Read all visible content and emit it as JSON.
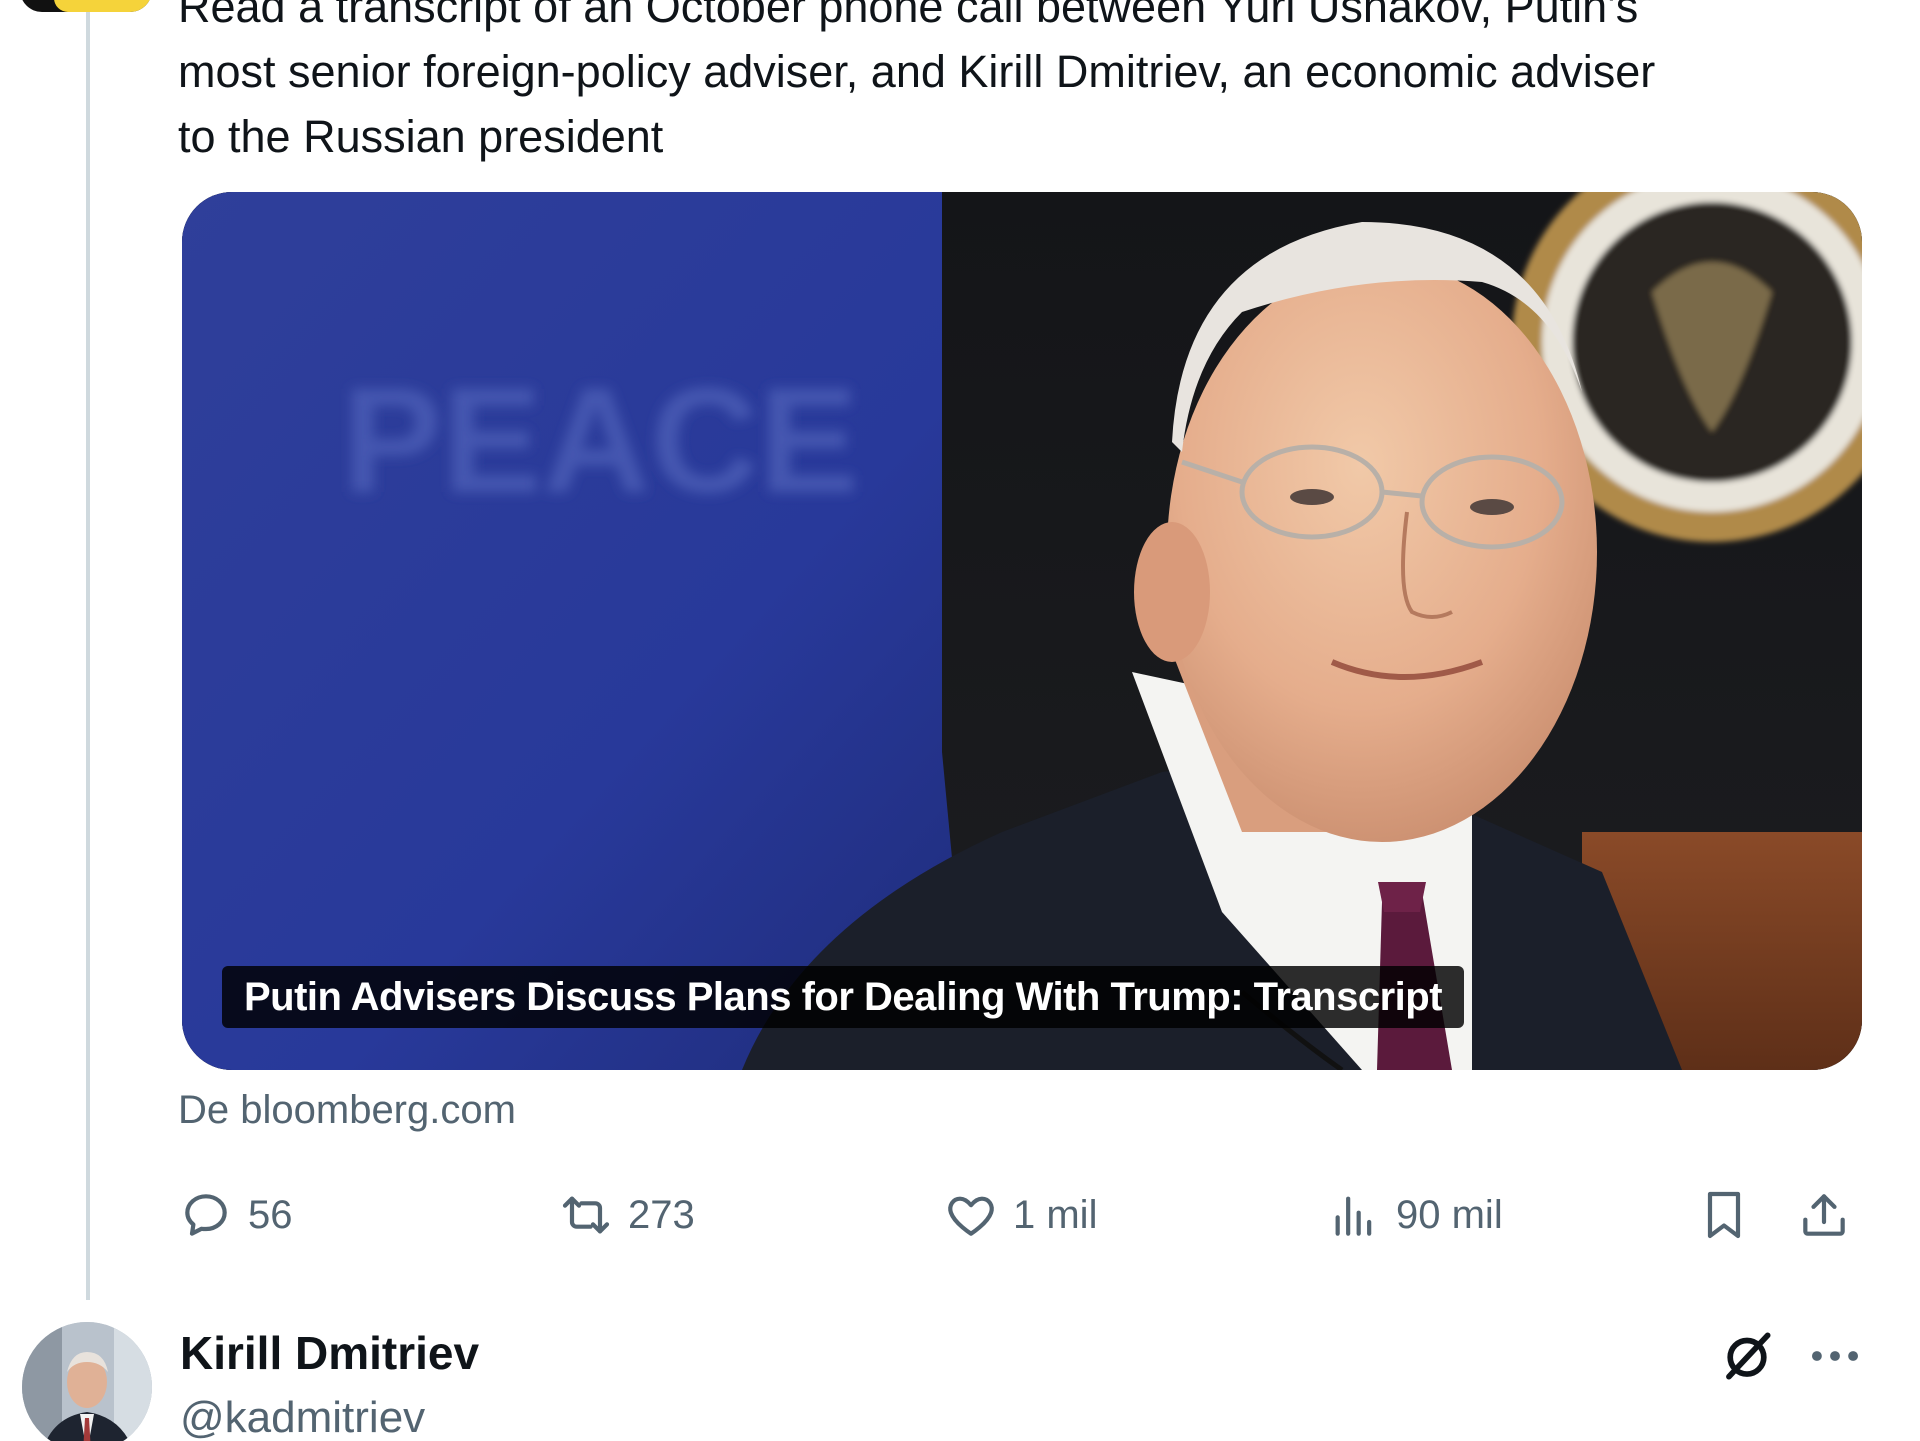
{
  "tweet": {
    "text": "Read a transcript of an October phone call between Yuri Ushakov, Putin's\nmost senior foreign-policy adviser, and Kirill Dmitriev, an economic adviser\nto the Russian president",
    "card": {
      "caption": "Putin Advisers Discuss Plans for Dealing With Trump: Transcript",
      "background_sign_text": "PEACE"
    },
    "source": "De bloomberg.com",
    "actions": {
      "replies": "56",
      "reposts": "273",
      "likes": "1 mil",
      "views": "90 mil"
    }
  },
  "next_tweet": {
    "author_name": "Kirill Dmitriev",
    "author_handle": "@kadmitriev"
  },
  "colors": {
    "secondary_text": "#536471",
    "primary_text": "#0f1419",
    "thread_line": "#cfd9de"
  }
}
